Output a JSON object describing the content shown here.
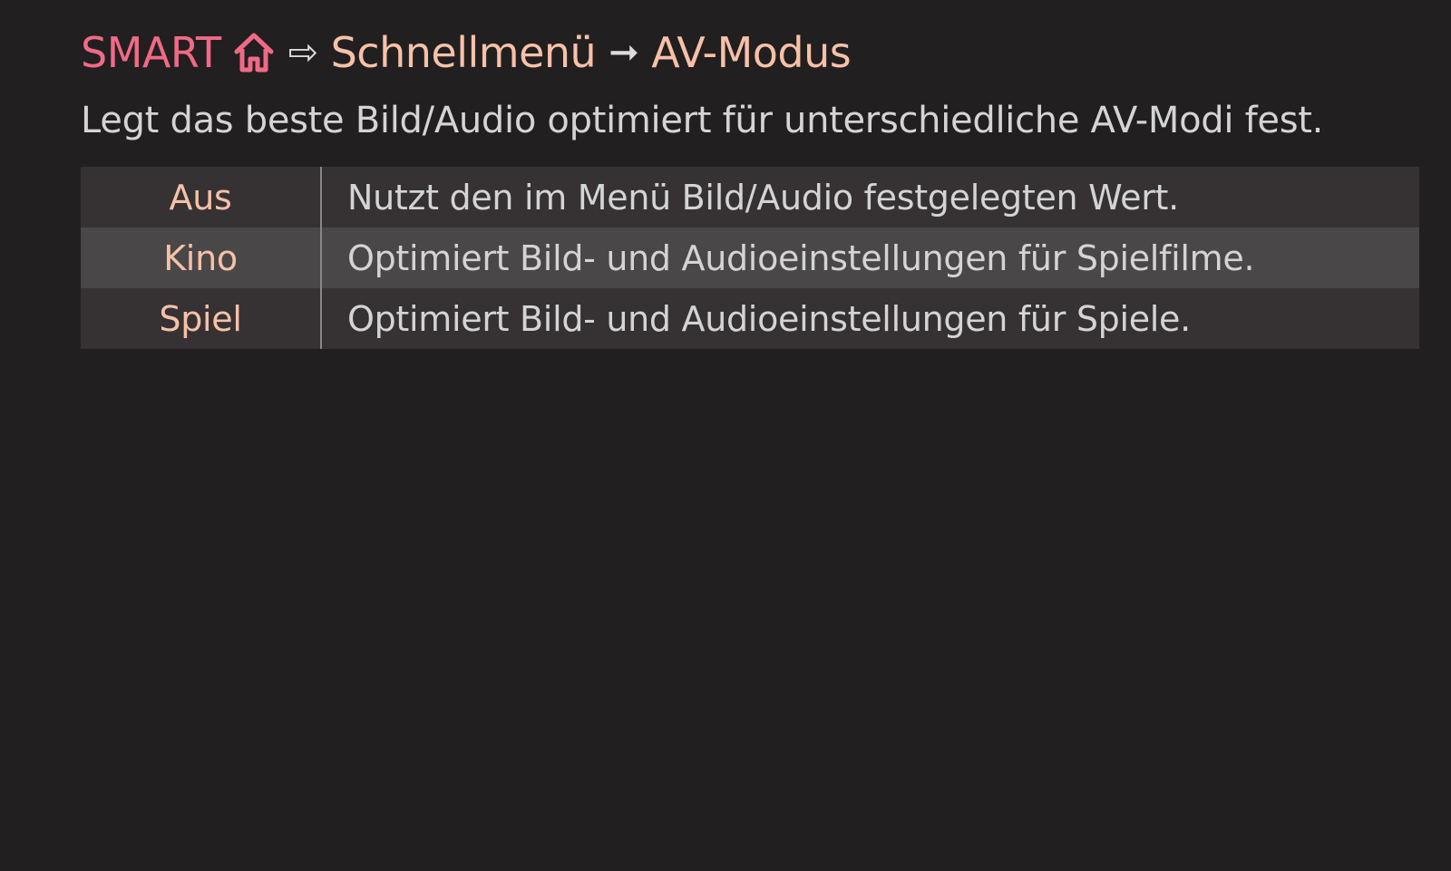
{
  "header": {
    "smart_label": "SMART",
    "home_icon": "home-icon",
    "arrow_hollow": "⇨",
    "crumb_1": "Schnellmenü",
    "arrow_solid": "➞",
    "crumb_2": "AV-Modus"
  },
  "description": "Legt das beste Bild/Audio optimiert für unterschiedliche AV-Modi fest.",
  "colors": {
    "background": "#221f20",
    "smart_accent": "#f06a86",
    "crumb_color": "#f7c1a8",
    "text": "#d4d4d4"
  },
  "options": [
    {
      "name": "Aus",
      "desc": "Nutzt den im Menü Bild/Audio festgelegten Wert."
    },
    {
      "name": "Kino",
      "desc": "Optimiert Bild- und Audioeinstellungen für Spielfilme."
    },
    {
      "name": "Spiel",
      "desc": "Optimiert Bild- und Audioeinstellungen für Spiele."
    }
  ]
}
